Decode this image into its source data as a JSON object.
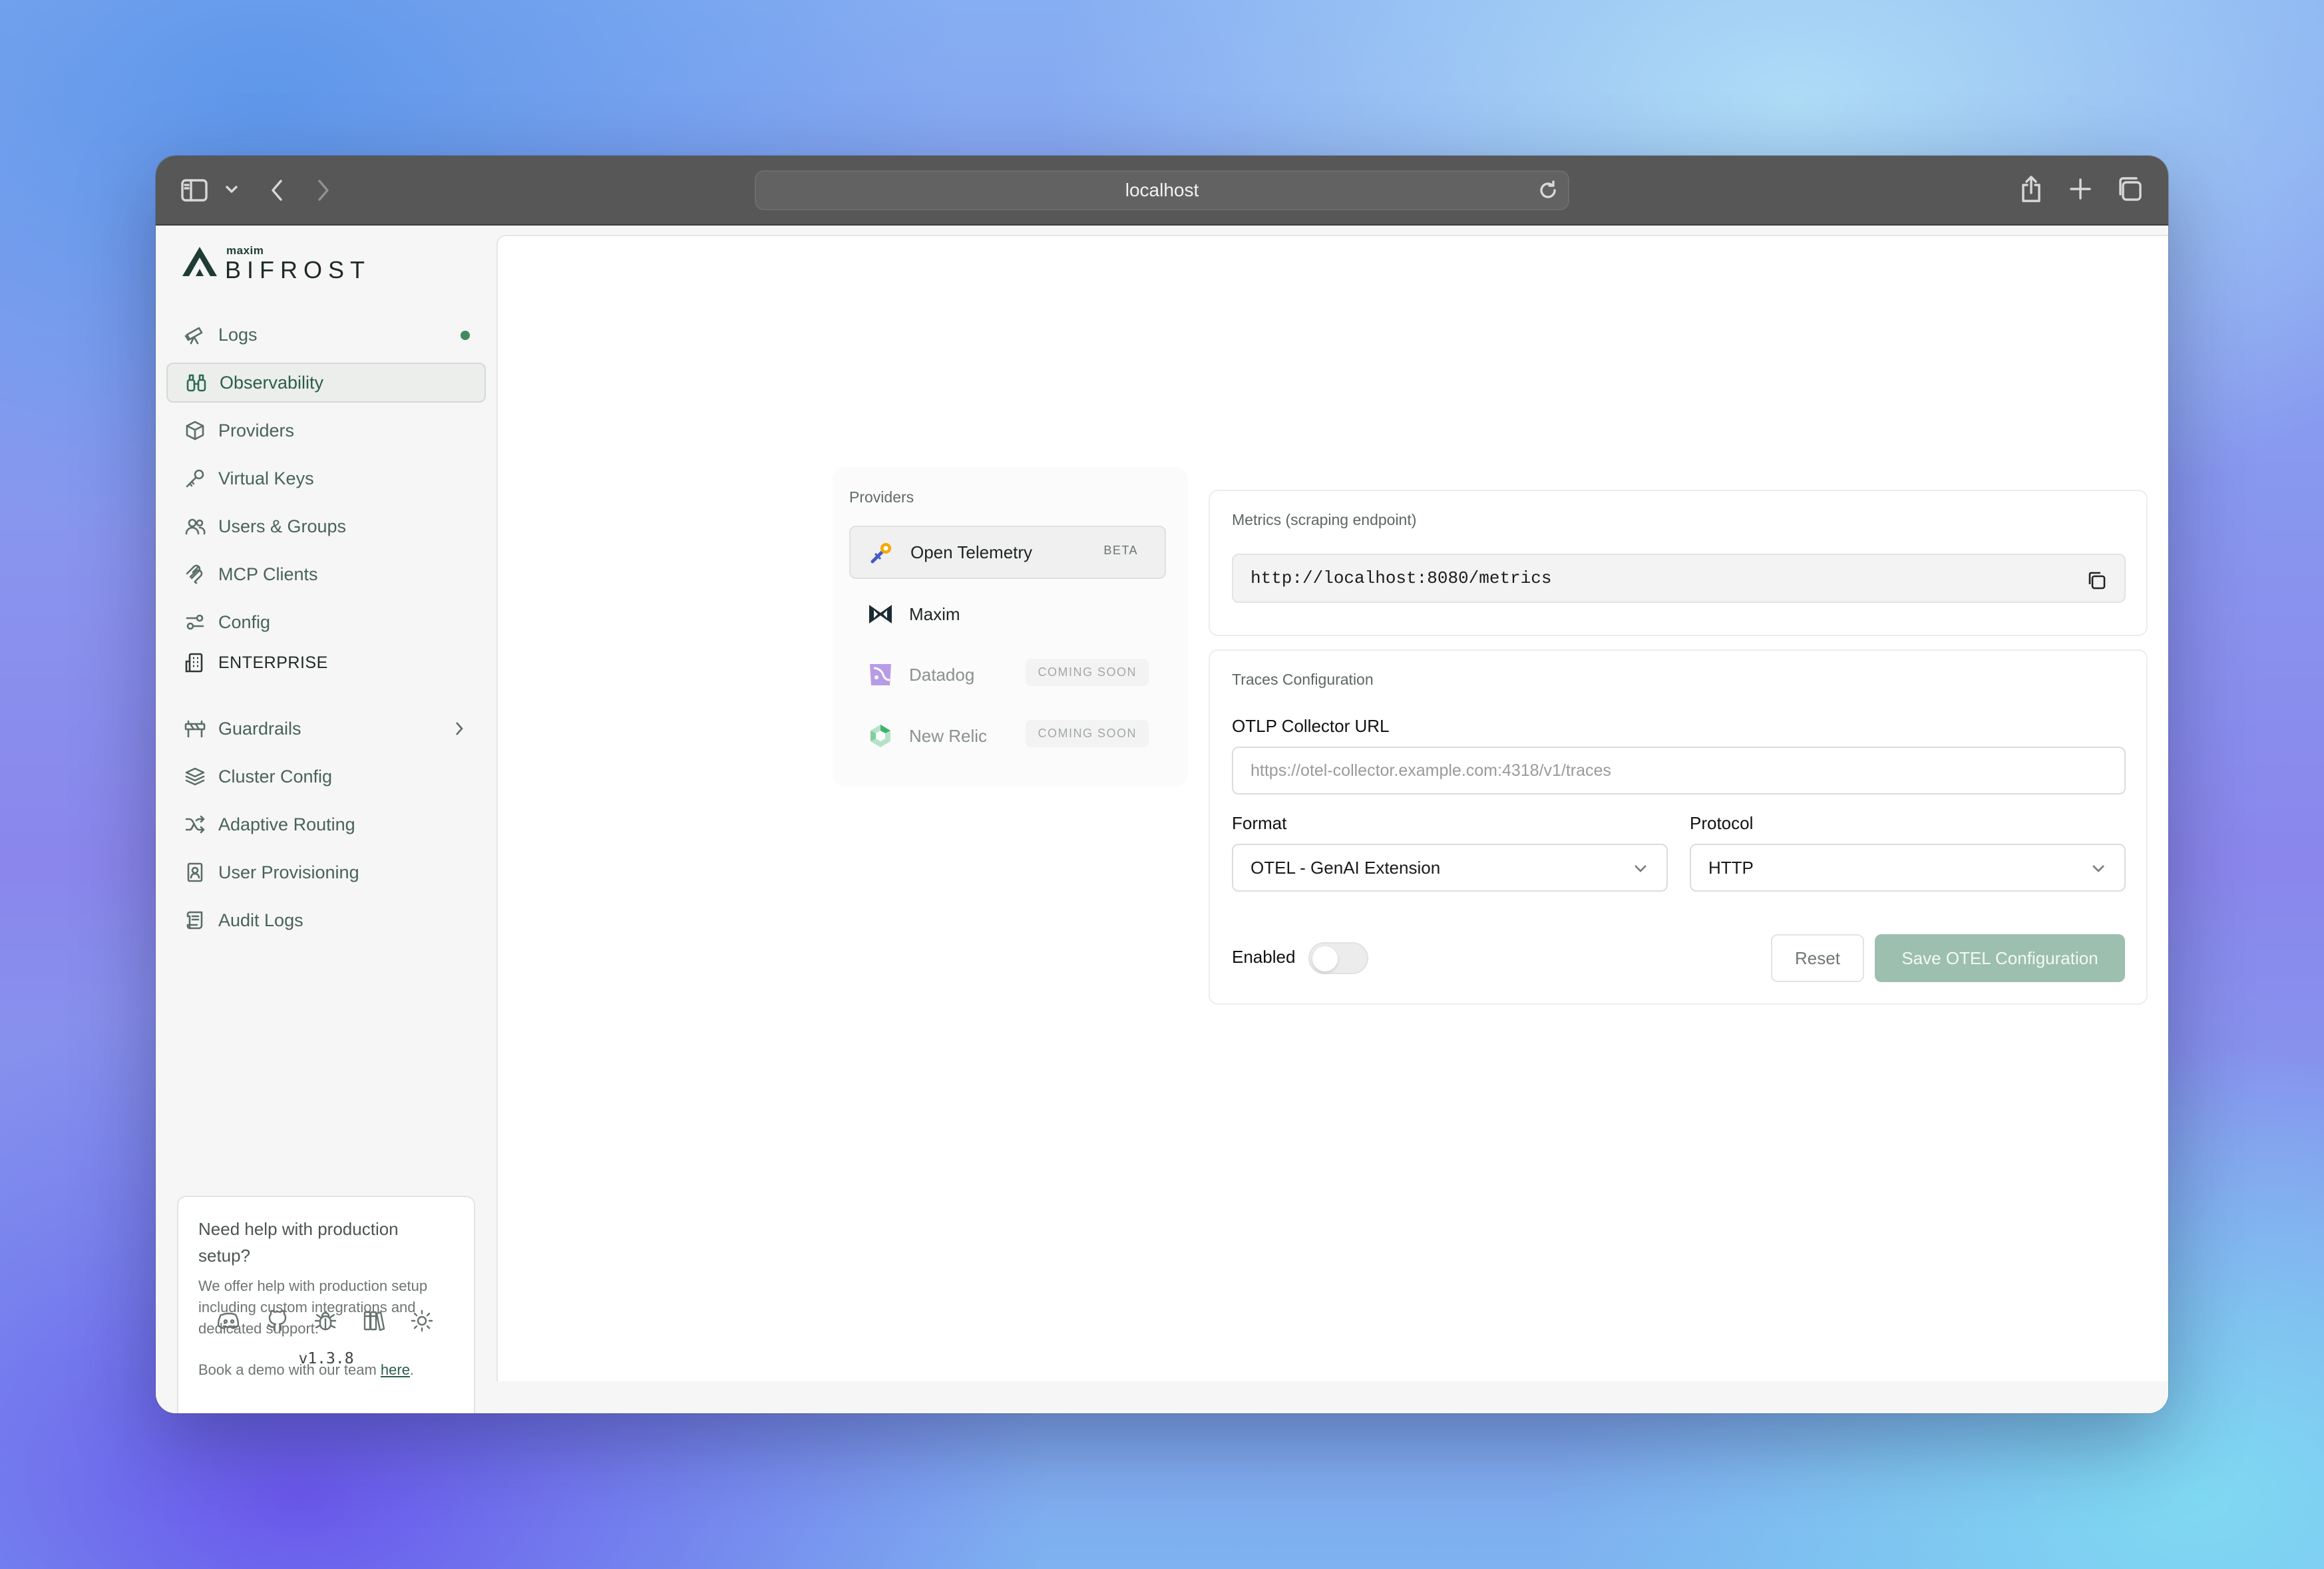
{
  "browser": {
    "url": "localhost"
  },
  "sidebar": {
    "logo_top": "maxim",
    "logo_name": "BIFROST",
    "items": [
      {
        "label": "Logs",
        "icon": "telescope-icon"
      },
      {
        "label": "Observability",
        "icon": "binoculars-icon"
      },
      {
        "label": "Providers",
        "icon": "cube-icon"
      },
      {
        "label": "Virtual Keys",
        "icon": "key-icon"
      },
      {
        "label": "Users & Groups",
        "icon": "users-icon"
      },
      {
        "label": "MCP Clients",
        "icon": "mcp-icon"
      },
      {
        "label": "Config",
        "icon": "settings-sliders-icon"
      }
    ],
    "section_label": "ENTERPRISE",
    "enterprise_items": [
      {
        "label": "Guardrails",
        "icon": "guardrail-icon"
      },
      {
        "label": "Cluster Config",
        "icon": "layers-icon"
      },
      {
        "label": "Adaptive Routing",
        "icon": "shuffle-icon"
      },
      {
        "label": "User Provisioning",
        "icon": "contact-book-icon"
      },
      {
        "label": "Audit Logs",
        "icon": "scroll-icon"
      }
    ],
    "help": {
      "title": "Need help with production setup?",
      "body": "We offer help with production setup including custom integrations and dedicated support.",
      "demo_prefix": "Book a demo with our team ",
      "demo_link": "here",
      "demo_suffix": "."
    },
    "footer_icons": [
      "discord-icon",
      "github-icon",
      "bug-icon",
      "book-icon",
      "sun-icon"
    ],
    "version": "v1.3.8",
    "accent_color": "#2b6b53"
  },
  "providers": {
    "title": "Providers",
    "items": [
      {
        "label": "Open Telemetry",
        "badge": "BETA",
        "icon": "opentelemetry-icon"
      },
      {
        "label": "Maxim",
        "badge": "",
        "icon": "maxim-icon"
      },
      {
        "label": "Datadog",
        "badge": "COMING SOON",
        "icon": "datadog-icon"
      },
      {
        "label": "New Relic",
        "badge": "COMING SOON",
        "icon": "newrelic-icon"
      }
    ]
  },
  "metrics": {
    "title": "Metrics (scraping endpoint)",
    "endpoint": "http://localhost:8080/metrics"
  },
  "traces": {
    "title": "Traces Configuration",
    "collector_label": "OTLP Collector URL",
    "collector_placeholder": "https://otel-collector.example.com:4318/v1/traces",
    "format_label": "Format",
    "format_value": "OTEL - GenAI Extension",
    "protocol_label": "Protocol",
    "protocol_value": "HTTP",
    "enabled_label": "Enabled",
    "enabled": false,
    "reset_label": "Reset",
    "save_label": "Save OTEL Configuration"
  }
}
